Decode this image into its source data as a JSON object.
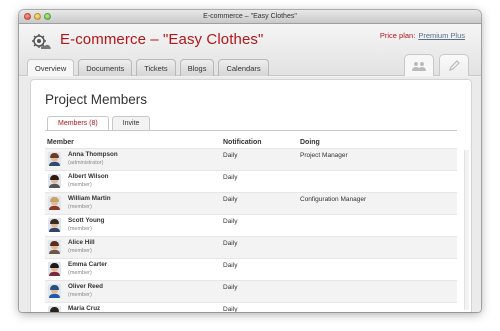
{
  "window": {
    "title": "E-commerce – \"Easy Clothes\""
  },
  "header": {
    "app_title": "E-commerce – \"Easy Clothes\"",
    "price_label": "Price plan:",
    "price_plan": "Premium Plus",
    "brand_color": "#b4161b",
    "logo_icon": "gear-cloud-icon"
  },
  "nav": {
    "tabs": [
      {
        "label": "Overview"
      },
      {
        "label": "Documents"
      },
      {
        "label": "Tickets"
      },
      {
        "label": "Blogs"
      },
      {
        "label": "Calendars"
      }
    ],
    "tool_tabs": [
      {
        "icon": "people-icon",
        "active": true
      },
      {
        "icon": "pencil-icon",
        "active": false
      }
    ]
  },
  "page": {
    "title": "Project Members",
    "sub_tabs": [
      {
        "label": "Members (8)",
        "active": true
      },
      {
        "label": "Invite",
        "active": false
      }
    ]
  },
  "table": {
    "columns": [
      "Member",
      "Notification",
      "Doing"
    ],
    "rows": [
      {
        "name": "Anna Thompson",
        "role": "(administrator)",
        "notification": "Daily",
        "doing": "Project Manager",
        "avatar": {
          "hair": "#6b3b22",
          "shirt": "#2f4a6b"
        }
      },
      {
        "name": "Albert Wilson",
        "role": "(member)",
        "notification": "Daily",
        "doing": "",
        "avatar": {
          "hair": "#2b1d14",
          "shirt": "#555555"
        }
      },
      {
        "name": "William Martin",
        "role": "(member)",
        "notification": "Daily",
        "doing": "Configuration Manager",
        "avatar": {
          "hair": "#c9a26a",
          "shirt": "#8a3b2a"
        }
      },
      {
        "name": "Scott Young",
        "role": "(member)",
        "notification": "Daily",
        "doing": "",
        "avatar": {
          "hair": "#3a2a1d",
          "shirt": "#334466"
        }
      },
      {
        "name": "Alice Hill",
        "role": "(member)",
        "notification": "Daily",
        "doing": "",
        "avatar": {
          "hair": "#5a2e1b",
          "shirt": "#6a5a4a"
        }
      },
      {
        "name": "Emma Carter",
        "role": "(member)",
        "notification": "Daily",
        "doing": "",
        "avatar": {
          "hair": "#1f1a16",
          "shirt": "#7a2c3a"
        }
      },
      {
        "name": "Oliver Reed",
        "role": "(member)",
        "notification": "Daily",
        "doing": "",
        "avatar": {
          "hair": "#2a4f7a",
          "shirt": "#1f5aa8"
        }
      },
      {
        "name": "Maria Cruz",
        "role": "(member)",
        "notification": "Daily",
        "doing": "",
        "avatar": {
          "hair": "#2b2018",
          "shirt": "#4a6a8a"
        }
      }
    ]
  }
}
